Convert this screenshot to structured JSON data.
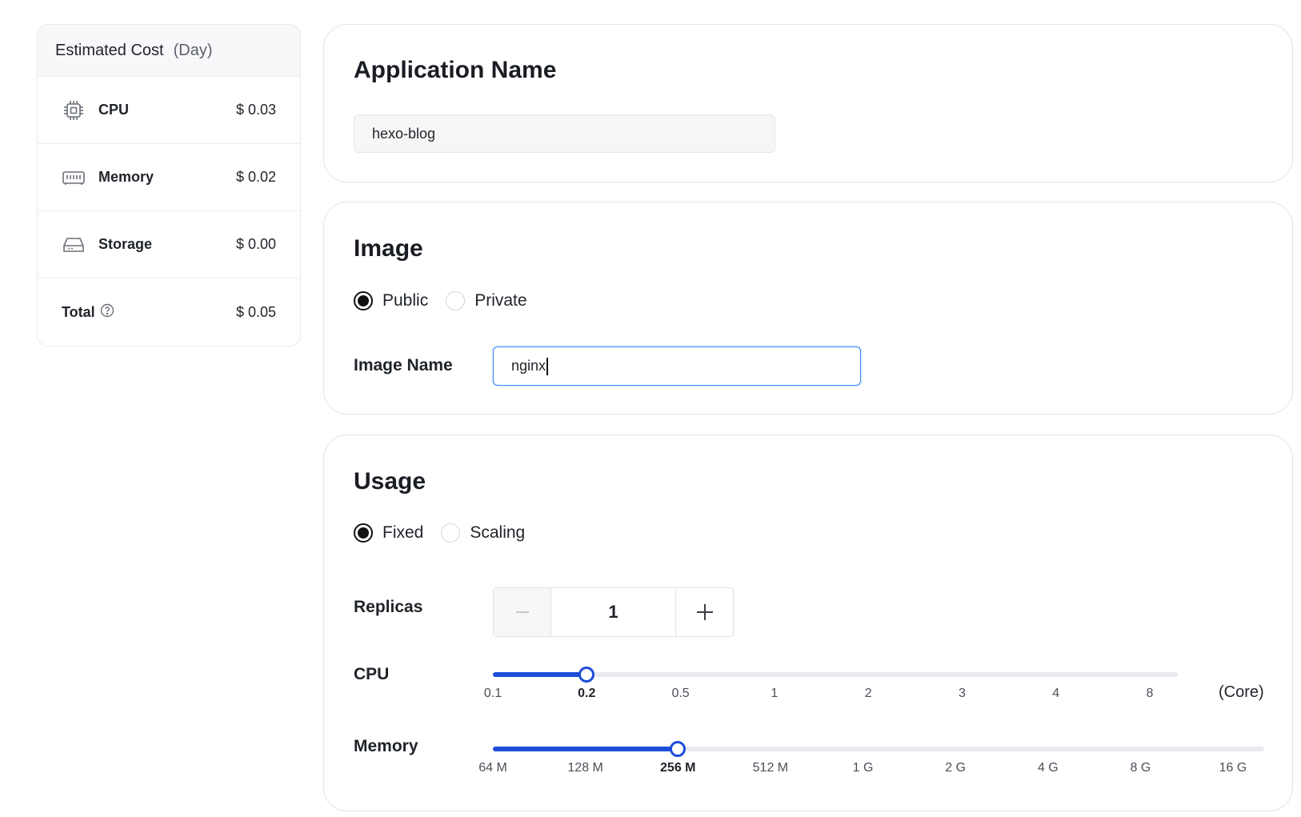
{
  "cost": {
    "title": "Estimated Cost",
    "period": "(Day)",
    "rows": [
      {
        "label": "CPU",
        "value": "$ 0.03",
        "icon": "cpu-icon"
      },
      {
        "label": "Memory",
        "value": "$ 0.02",
        "icon": "memory-icon"
      },
      {
        "label": "Storage",
        "value": "$ 0.00",
        "icon": "storage-icon"
      }
    ],
    "total": {
      "label": "Total",
      "value": "$ 0.05",
      "icon": "help-circle-icon"
    }
  },
  "app": {
    "heading": "Application Name",
    "value": "hexo-blog"
  },
  "image": {
    "heading": "Image",
    "options": [
      "Public",
      "Private"
    ],
    "selected": "Public",
    "name_label": "Image Name",
    "name_value": "nginx"
  },
  "usage": {
    "heading": "Usage",
    "options": [
      "Fixed",
      "Scaling"
    ],
    "selected": "Fixed",
    "replicas_label": "Replicas",
    "replicas_value": "1",
    "cpu": {
      "label": "CPU",
      "ticks": [
        "0.1",
        "0.2",
        "0.5",
        "1",
        "2",
        "3",
        "4",
        "8"
      ],
      "selected_index": 1,
      "unit": "(Core)"
    },
    "memory": {
      "label": "Memory",
      "ticks": [
        "64 M",
        "128 M",
        "256 M",
        "512 M",
        "1 G",
        "2 G",
        "4 G",
        "8 G",
        "16 G"
      ],
      "selected_index": 2
    }
  },
  "colors": {
    "accent": "#1d4ed8",
    "focus": "#3b82f6"
  }
}
